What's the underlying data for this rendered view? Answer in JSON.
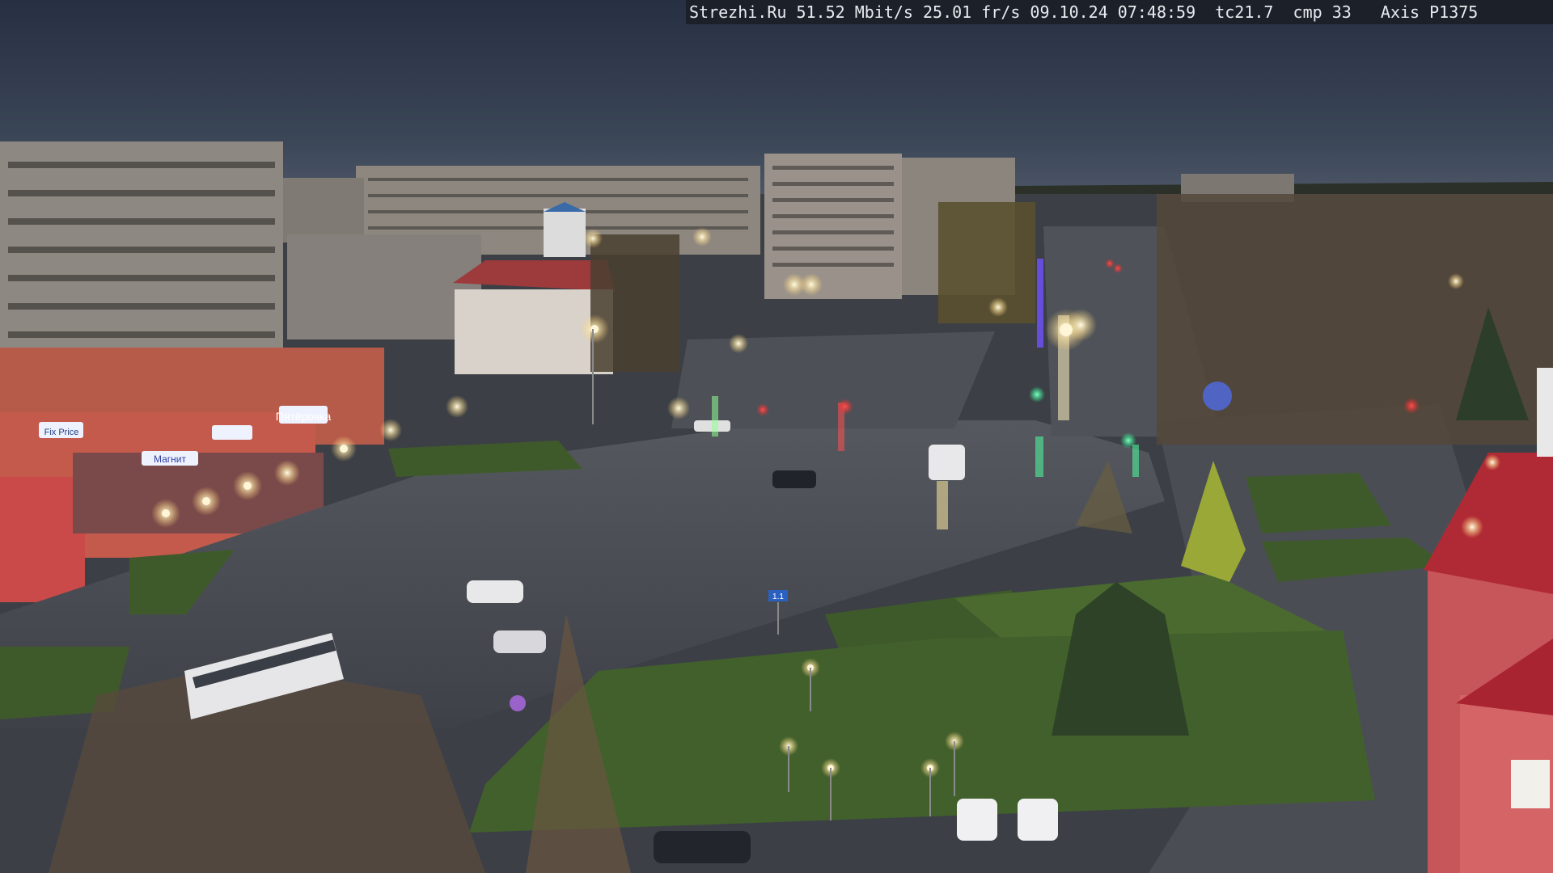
{
  "camera": {
    "overlay_text": "Strezhi.Ru 51.52 Mbit/s 25.01 fr/s 09.10.24 07:48:59  tc21.7  cmp 33   Axis P1375"
  },
  "storefronts": {
    "sign_1": "Пятёрочка",
    "sign_2": "Магнит",
    "sign_3": "Fix Price"
  },
  "road_sign": {
    "text": "1.1"
  },
  "colors": {
    "sky_top": "#2a3344",
    "sky_horizon": "#4a5566",
    "asphalt": "#4a4e55",
    "grass": "#3f5a2a",
    "building_grey": "#8a8680",
    "building_red": "#b5454a",
    "street_light": "#fff6d8",
    "traffic_red": "#ff3030",
    "traffic_green": "#30ff90"
  }
}
